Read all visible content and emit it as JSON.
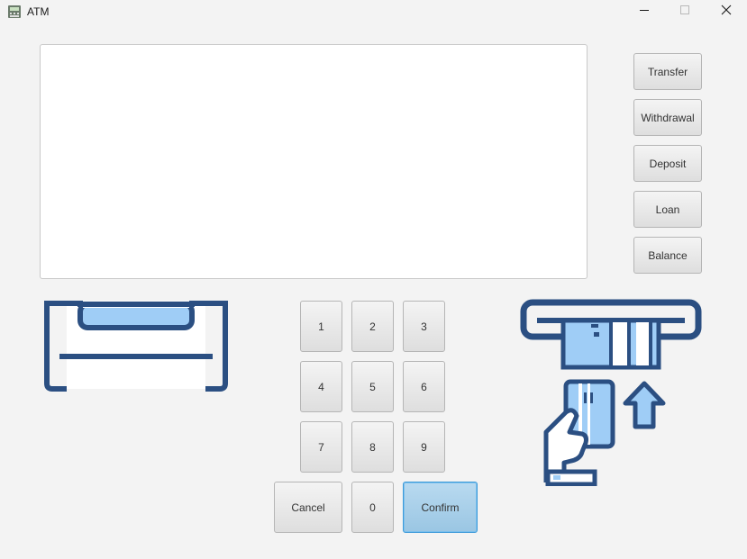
{
  "window": {
    "title": "ATM",
    "icon": "atm-app-icon",
    "controls": {
      "minimize": "minimize-icon",
      "maximize": "maximize-icon",
      "close": "close-icon"
    }
  },
  "display": {
    "text": ""
  },
  "side_buttons": {
    "transfer": "Transfer",
    "withdrawal": "Withdrawal",
    "deposit": "Deposit",
    "loan": "Loan",
    "balance": "Balance"
  },
  "keypad": {
    "k1": "1",
    "k2": "2",
    "k3": "3",
    "k4": "4",
    "k5": "5",
    "k6": "6",
    "k7": "7",
    "k8": "8",
    "k9": "9",
    "k0": "0",
    "cancel": "Cancel",
    "confirm": "Confirm"
  },
  "illustrations": {
    "cash_dispenser": "cash-dispenser-icon",
    "card_insert": "card-insert-icon"
  },
  "colors": {
    "icon_dark": "#2b4f82",
    "icon_light": "#9fcdf6",
    "confirm_border": "#3c9ad9",
    "confirm_fill": "#a9d0ea"
  }
}
